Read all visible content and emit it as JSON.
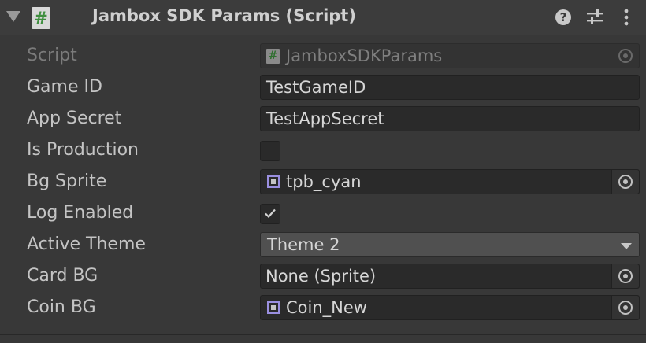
{
  "header": {
    "foldout_icon": "triangle-down-icon",
    "script_icon_glyph": "#",
    "title": "Jambox SDK Params (Script)",
    "help_glyph": "?",
    "presets_icon": "sliders-icon",
    "menu_icon": "kebab-menu-icon"
  },
  "fields": {
    "script": {
      "label": "Script",
      "value": "JamboxSDKParams",
      "icon_glyph": "#"
    },
    "game_id": {
      "label": "Game ID",
      "value": "TestGameID"
    },
    "app_secret": {
      "label": "App Secret",
      "value": "TestAppSecret"
    },
    "is_production": {
      "label": "Is Production",
      "checked": false
    },
    "bg_sprite": {
      "label": "Bg Sprite",
      "value": "tpb_cyan",
      "icon": "sprite-icon"
    },
    "log_enabled": {
      "label": "Log Enabled",
      "checked": true
    },
    "active_theme": {
      "label": "Active Theme",
      "value": "Theme 2"
    },
    "card_bg": {
      "label": "Card BG",
      "value": "None (Sprite)"
    },
    "coin_bg": {
      "label": "Coin BG",
      "value": "Coin_New",
      "icon": "sprite-icon"
    }
  },
  "colors": {
    "background": "#383838",
    "header": "#3c3c3c",
    "field": "#2a2a2a",
    "dropdown": "#505050",
    "sprite_icon_accent": "#9a8fe0",
    "script_icon_green": "#3f8f3f"
  }
}
